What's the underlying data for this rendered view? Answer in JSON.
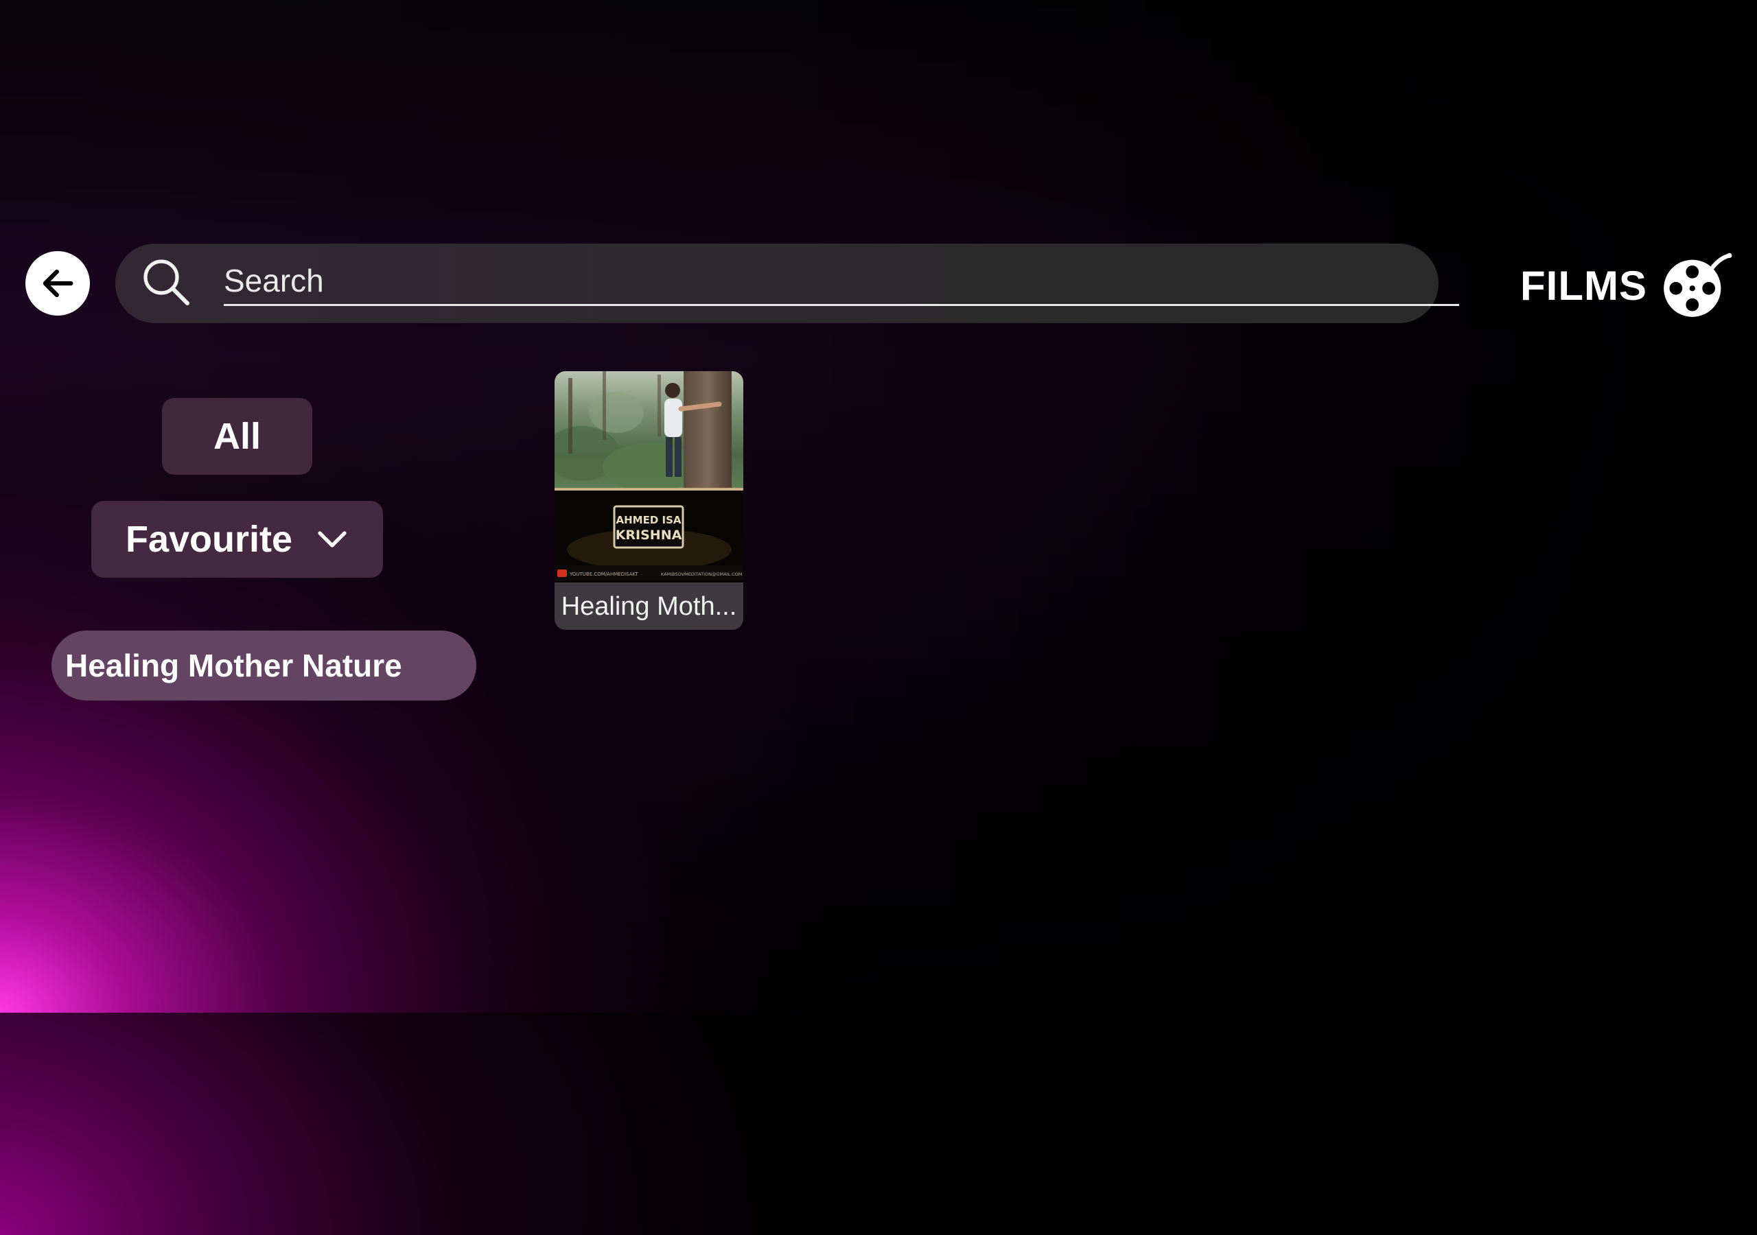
{
  "header": {
    "back_icon": "arrow-left-icon",
    "search": {
      "placeholder": "Search",
      "value": "",
      "icon": "magnifier-icon"
    },
    "section_title": "FILMS",
    "section_icon": "film-reel-icon"
  },
  "filters": {
    "all_label": "All",
    "favourite_label": "Favourite",
    "favourite_icon": "chevron-down-icon",
    "selected_playlist": "Healing Mother Nature"
  },
  "films": [
    {
      "title": "Healing Moth...",
      "thumbnail_text_line1": "AHMED ISA",
      "thumbnail_text_line2": "KRISHNA",
      "thumbnail_footer_left": "YOUTUBE.COM/AHMEDISAKT",
      "thumbnail_footer_right": "KAMIBSOVMEDITATION@GMAIL.COM"
    }
  ],
  "colors": {
    "accent_glow": "#ff37e1",
    "button_bg": "#41283d",
    "pill_bg": "#634563",
    "search_bg": "#2c2a2c"
  }
}
